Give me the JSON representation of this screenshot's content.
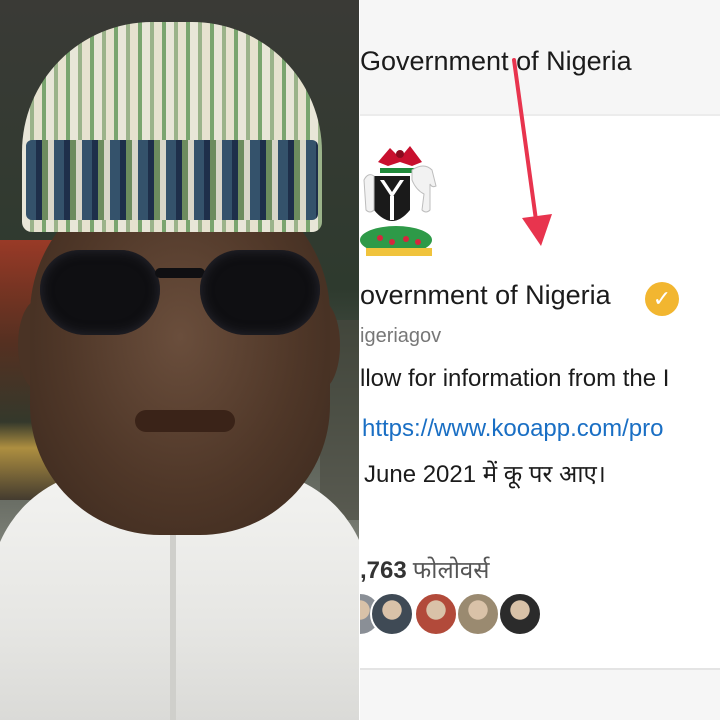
{
  "photo": {
    "subject": "portrait photo"
  },
  "screenshot": {
    "header_title": "Government of Nigeria",
    "profile": {
      "name": "overnment of Nigeria",
      "handle": "igeriagov",
      "bio": "llow for information from the I",
      "link": "https://www.kooapp.com/pro",
      "joined": "June 2021 में कू पर आए।",
      "followers_count": ",763",
      "followers_label": "फोलोवर्स",
      "verified_badge_icon": "checkmark-icon"
    },
    "follower_avatars": [
      {
        "color": "#8a8f96"
      },
      {
        "color": "#3f4a55"
      },
      {
        "color": "#b24a3a"
      },
      {
        "color": "#9a8a70"
      },
      {
        "color": "#2b2b2b"
      }
    ]
  },
  "annotation": {
    "arrow_color": "#e8344e"
  }
}
